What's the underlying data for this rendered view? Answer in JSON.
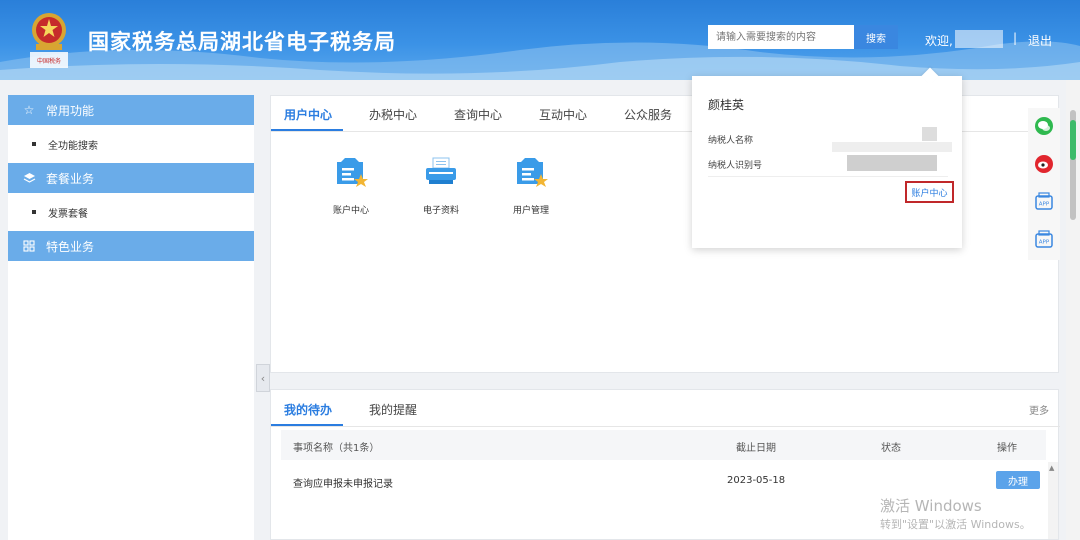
{
  "header": {
    "emblem_caption": "中国税务",
    "title": "国家税务总局湖北省电子税务局",
    "search_placeholder": "请输入需要搜索的内容",
    "search_button": "搜索",
    "welcome": "欢迎,",
    "separator": "|",
    "logout": "退出"
  },
  "sidebar": {
    "groups": [
      {
        "label": "常用功能",
        "icon": "star-icon",
        "items": [
          "全功能搜索"
        ]
      },
      {
        "label": "套餐业务",
        "icon": "layers-icon",
        "items": [
          "发票套餐"
        ]
      },
      {
        "label": "特色业务",
        "icon": "grid-icon",
        "items": []
      }
    ]
  },
  "main_tabs": [
    "用户中心",
    "办税中心",
    "查询中心",
    "互动中心",
    "公众服务"
  ],
  "apps": [
    {
      "label": "账户中心",
      "icon": "account-icon"
    },
    {
      "label": "电子资料",
      "icon": "printer-icon"
    },
    {
      "label": "用户管理",
      "icon": "user-manage-icon"
    }
  ],
  "popup": {
    "name": "颜桂英",
    "taxpayer_name_label": "纳税人名称",
    "taxpayer_id_label": "纳税人识别号",
    "account_center_link": "账户中心"
  },
  "todo": {
    "tabs": [
      "我的待办",
      "我的提醒"
    ],
    "more": "更多",
    "columns": [
      "事项名称（共1条）",
      "截止日期",
      "状态",
      "操作"
    ],
    "rows": [
      {
        "name": "查询应申报未申报记录",
        "deadline": "2023-05-18",
        "status": "",
        "action": "办理"
      }
    ]
  },
  "float_icons": [
    "wechat-icon",
    "weibo-icon",
    "app-icon",
    "app-icon"
  ],
  "watermark": {
    "line1": "激活 Windows",
    "line2": "转到\"设置\"以激活 Windows。"
  },
  "colors": {
    "header_blue": "#2a7fd9",
    "sidebar_group": "#6aace9",
    "accent": "#2b7de0",
    "highlight_box": "#c0282a"
  }
}
